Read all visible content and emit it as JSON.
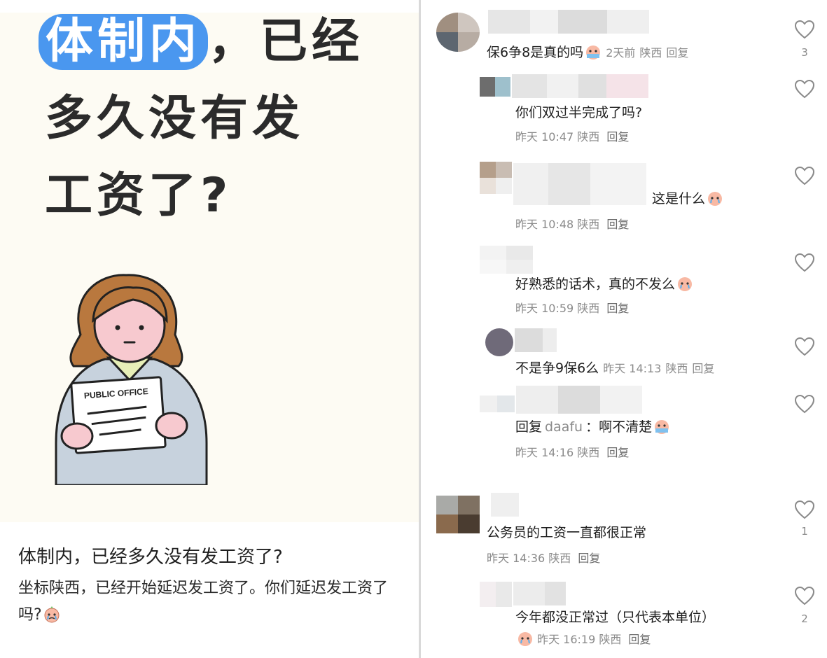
{
  "post": {
    "headline_highlight": "体制内",
    "headline_line1_rest": "，已经",
    "headline_line2": "多久没有发",
    "headline_line3": "工资了?",
    "illustration_sign": "PUBLIC OFFICE",
    "title": "体制内，已经多久没有发工资了?",
    "body": "坐标陕西，已经开始延迟发工资了。你们延迟发工资了吗?"
  },
  "comments": [
    {
      "text": "保6争8是真的吗",
      "time": "2天前",
      "location": "陕西",
      "reply": "回复",
      "likes": "3",
      "level": 0
    },
    {
      "text": "你们双过半完成了吗?",
      "time": "昨天 10:47",
      "location": "陕西",
      "reply": "回复",
      "likes": "",
      "level": 1
    },
    {
      "text": "这是什么",
      "time": "昨天 10:48",
      "location": "陕西",
      "reply": "回复",
      "likes": "",
      "level": 1
    },
    {
      "text": "好熟悉的话术，真的不发么",
      "time": "昨天 10:59",
      "location": "陕西",
      "reply": "回复",
      "likes": "",
      "level": 1
    },
    {
      "text": "不是争9保6么",
      "time": "昨天 14:13",
      "location": "陕西",
      "reply": "回复",
      "likes": "",
      "level": 1
    },
    {
      "text_prefix": "回复",
      "reply_to": "daafu",
      "text": "：啊不清楚",
      "time": "昨天 14:16",
      "location": "陕西",
      "reply": "回复",
      "likes": "",
      "level": 1
    },
    {
      "text": "公务员的工资一直都很正常",
      "time": "昨天 14:36",
      "location": "陕西",
      "reply": "回复",
      "likes": "1",
      "level": 0
    },
    {
      "text": "今年都没正常过（只代表本单位）",
      "time": "昨天 16:19",
      "location": "陕西",
      "reply": "回复",
      "likes": "2",
      "level": 1
    }
  ],
  "colors": {
    "accent": "#4a97ef",
    "meta": "#8a8a8a"
  },
  "icons": [
    "heart-icon",
    "crying-emoji-icon"
  ]
}
